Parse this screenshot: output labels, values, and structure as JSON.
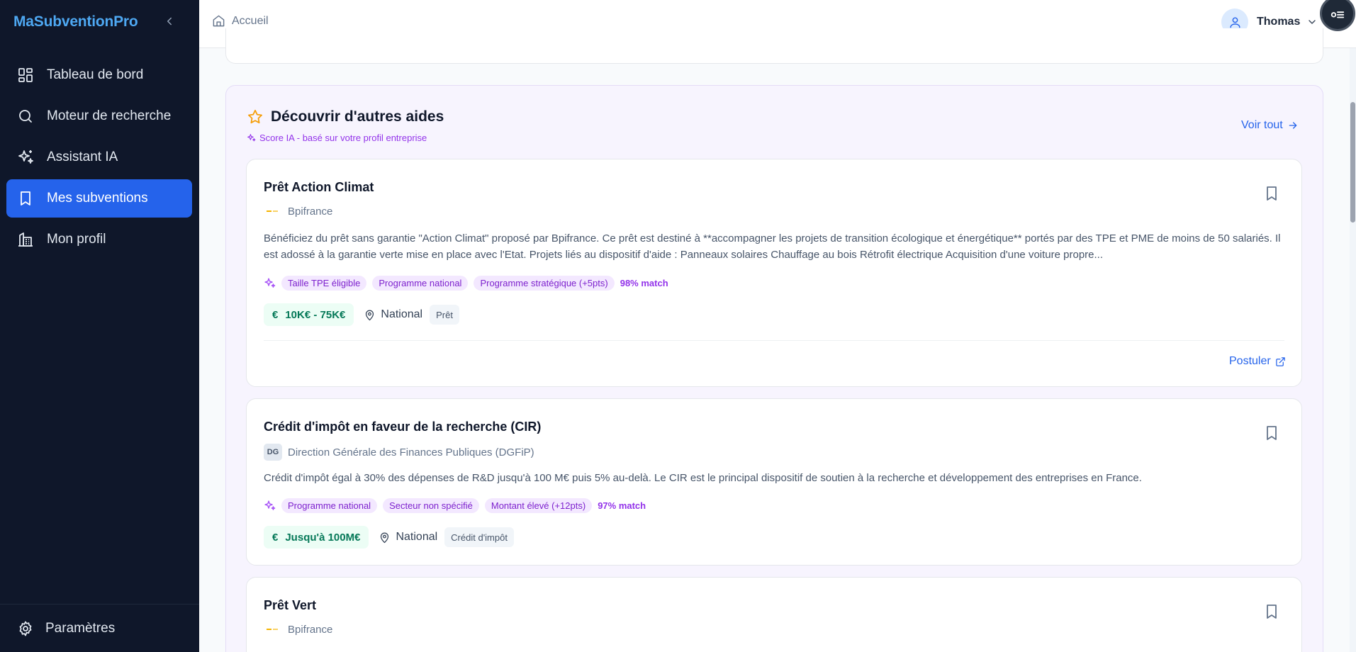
{
  "app": {
    "brand": "MaSubventionPro"
  },
  "sidebar": {
    "items": [
      {
        "label": "Tableau de bord",
        "icon": "dashboard-icon"
      },
      {
        "label": "Moteur de recherche",
        "icon": "search-icon"
      },
      {
        "label": "Assistant IA",
        "icon": "sparkles-icon"
      },
      {
        "label": "Mes subventions",
        "icon": "bookmark-icon",
        "active": true
      },
      {
        "label": "Mon profil",
        "icon": "profile-icon"
      }
    ],
    "settings_label": "Paramètres"
  },
  "header": {
    "breadcrumb": "Accueil",
    "user_name": "Thomas"
  },
  "panel": {
    "title": "Découvrir d'autres aides",
    "subtitle": "Score IA - basé sur votre profil entreprise",
    "see_all": "Voir tout"
  },
  "cards": [
    {
      "title": "Prêt Action Climat",
      "org": "Bpifrance",
      "description": "Bénéficiez du prêt sans garantie \"Action Climat\" proposé par Bpifrance. Ce prêt est destiné à **accompagner les projets de transition écologique et énergétique** portés par des TPE et PME de moins de 50 salariés. Il est adossé à la garantie verte mise en place avec l'Etat. Projets liés au dispositif d'aide : Panneaux solaires Chauffage au bois Rétrofit électrique Acquisition d'une voiture propre...",
      "tags": [
        "Taille TPE éligible",
        "Programme national",
        "Programme stratégique (+5pts)"
      ],
      "match": "98% match",
      "amount": "10K€ - 75K€",
      "location": "National",
      "type": "Prêt",
      "apply": "Postuler"
    },
    {
      "title": "Crédit d'impôt en faveur de la recherche (CIR)",
      "org": "Direction Générale des Finances Publiques (DGFiP)",
      "org_initials": "DG",
      "description": "Crédit d'impôt égal à 30% des dépenses de R&D jusqu'à 100 M€ puis 5% au-delà. Le CIR est le principal dispositif de soutien à la recherche et développement des entreprises en France.",
      "tags": [
        "Programme national",
        "Secteur non spécifié",
        "Montant élevé (+12pts)"
      ],
      "match": "97% match",
      "amount": "Jusqu'à 100M€",
      "location": "National",
      "type": "Crédit d'impôt"
    },
    {
      "title": "Prêt Vert",
      "org": "Bpifrance"
    }
  ],
  "currency_symbol": "€",
  "colors": {
    "sidebar_bg": "#0f172a",
    "accent": "#2563eb",
    "brand": "#4ea8f2",
    "ai_purple": "#9333ea",
    "amount_green": "#047857"
  }
}
